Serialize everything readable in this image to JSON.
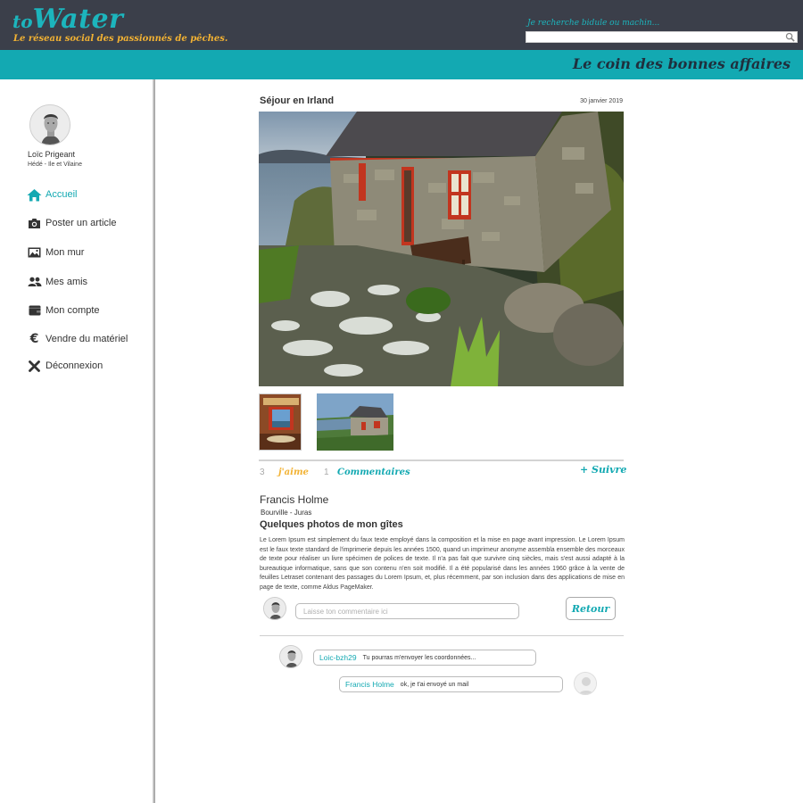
{
  "brand": {
    "to": "to",
    "name": "Water",
    "tagline": "Le réseau social des passionnés de pêches."
  },
  "search": {
    "label": "Je recherche bidule ou machin...",
    "placeholder": "",
    "icon": "search-icon"
  },
  "header": {
    "deals_link": "Le coin des bonnes affaires"
  },
  "colors": {
    "teal": "#13a9b2",
    "dark": "#3b3f4a",
    "orange": "#f2b233"
  },
  "profile": {
    "name": "Loïc Prigeant",
    "location": "Hédé - Ile et Vilaine"
  },
  "sidebar": {
    "items": [
      {
        "label": "Accueil",
        "icon": "home-icon",
        "active": true
      },
      {
        "label": "Poster un article",
        "icon": "camera-icon"
      },
      {
        "label": "Mon mur",
        "icon": "image-icon"
      },
      {
        "label": "Mes amis",
        "icon": "users-icon"
      },
      {
        "label": "Mon compte",
        "icon": "wallet-icon"
      },
      {
        "label": "Vendre du matériel",
        "icon": "euro-icon"
      },
      {
        "label": "Déconnexion",
        "icon": "close-icon"
      }
    ]
  },
  "post": {
    "title": "Séjour en Irland",
    "date": "30 janvier 2019",
    "likes_count": "3",
    "likes_label": "j'aime",
    "comments_count": "1",
    "comments_label": "Commentaires",
    "follow_label": "+ Suivre",
    "author_name": "Francis Holme",
    "author_location": "Bourville - Juras",
    "subtitle": "Quelques photos de mon gîtes",
    "body": "Le Lorem Ipsum est simplement du faux texte employé dans la composition et la mise en page avant impression. Le Lorem Ipsum est le faux texte standard de l'imprimerie depuis les années 1500, quand un imprimeur anonyme assembla ensemble des morceaux de texte pour réaliser un livre spécimen de polices de texte. Il n'a pas fait que survivre cinq siècles, mais s'est aussi adapté à la bureautique informatique, sans que son contenu n'en soit modifié. Il a été popularisé dans les années 1960 grâce à la vente de feuilles Letraset contenant des passages du Lorem Ipsum, et, plus récemment, par son inclusion dans des applications de mise en page de texte, comme Aldus PageMaker."
  },
  "comment_form": {
    "placeholder": "Laisse ton commentaire ici",
    "back_label": "Retour"
  },
  "comments": [
    {
      "user": "Loic-bzh29",
      "text": "Tu pourras m'envoyer les coordonnées..."
    },
    {
      "user": "Francis Holme",
      "text": "ok, je t'ai envoyé un mail"
    }
  ]
}
